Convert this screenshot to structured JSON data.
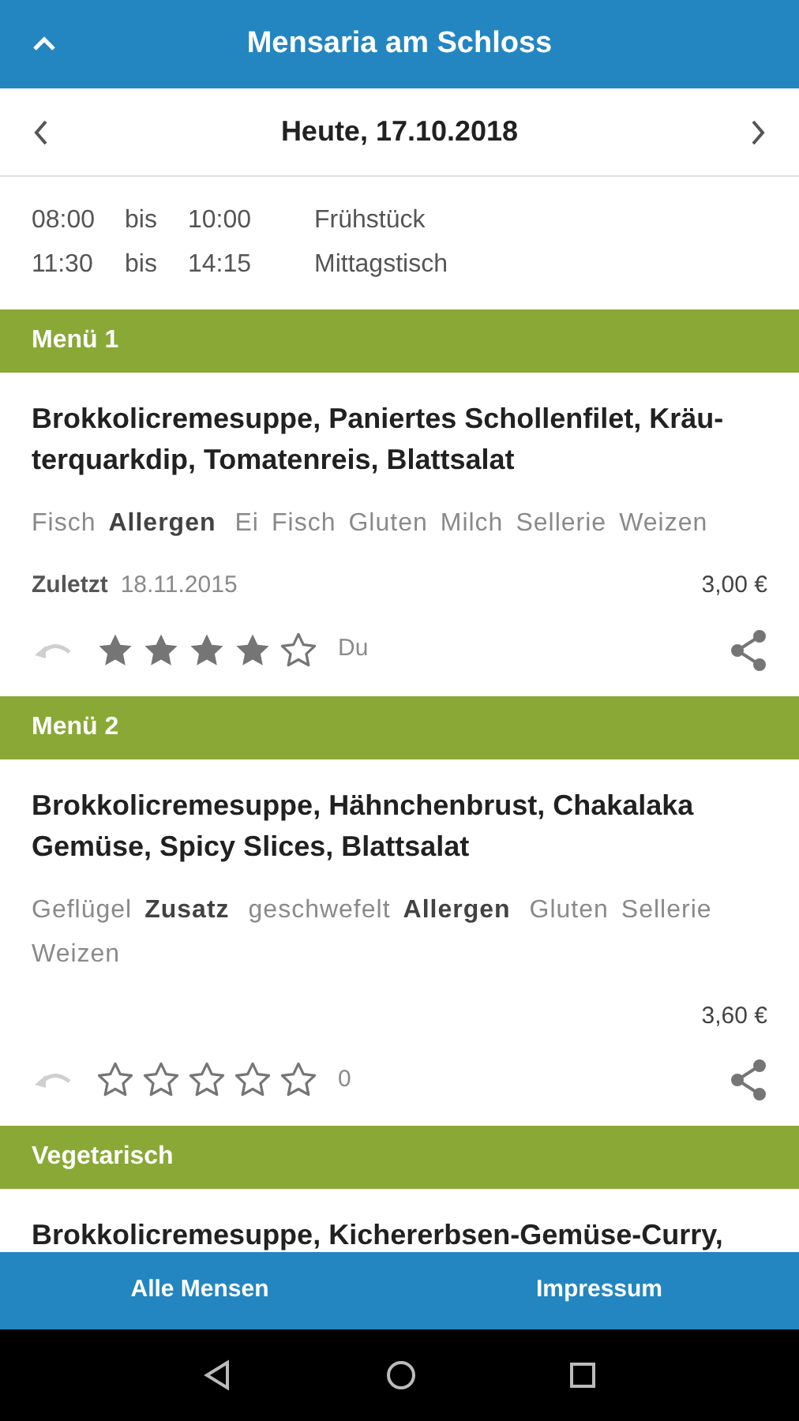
{
  "header": {
    "title": "Mensaria am Schloss"
  },
  "date_bar": {
    "date": "Heute, 17.10.2018"
  },
  "hours": [
    {
      "from": "08:00",
      "sep": "bis",
      "to": "10:00",
      "label": "Frühstück"
    },
    {
      "from": "11:30",
      "sep": "bis",
      "to": "14:15",
      "label": "Mittagstisch"
    }
  ],
  "menus": [
    {
      "title": "Menü 1",
      "dish": "Brokkolicremesuppe, Paniertes Schollenfilet, Kräu-terquarkdip, Tomatenreis, Blattsalat",
      "tags": [
        {
          "kind": "item",
          "text": "Fisch"
        },
        {
          "kind": "label",
          "text": "Allergen"
        },
        {
          "kind": "item",
          "text": "Ei"
        },
        {
          "kind": "item",
          "text": "Fisch"
        },
        {
          "kind": "item",
          "text": "Gluten"
        },
        {
          "kind": "item",
          "text": "Milch"
        },
        {
          "kind": "item",
          "text": "Sellerie"
        },
        {
          "kind": "item",
          "text": "Weizen"
        }
      ],
      "last_seen": {
        "label": "Zuletzt",
        "date": "18.11.2015"
      },
      "price": "3,00 €",
      "stars": 4,
      "rating_text": "Du"
    },
    {
      "title": "Menü 2",
      "dish": "Brokkolicremesuppe, Hähnchenbrust, Chakalaka Gemüse, Spicy Slices, Blattsalat",
      "tags": [
        {
          "kind": "item",
          "text": "Geflügel"
        },
        {
          "kind": "label",
          "text": "Zusatz"
        },
        {
          "kind": "item",
          "text": "geschwefelt"
        },
        {
          "kind": "label",
          "text": "Allergen"
        },
        {
          "kind": "item",
          "text": "Gluten"
        },
        {
          "kind": "item",
          "text": "Sellerie"
        },
        {
          "kind": "item",
          "text": "Weizen"
        }
      ],
      "price": "3,60 €",
      "stars": 0,
      "rating_text": "0"
    },
    {
      "title": "Vegetarisch",
      "dish": "Brokkolicremesuppe, Kichererbsen-Gemüse-Curry,"
    }
  ],
  "bottom_bar": [
    {
      "label": "Alle Mensen"
    },
    {
      "label": "Impressum"
    }
  ]
}
